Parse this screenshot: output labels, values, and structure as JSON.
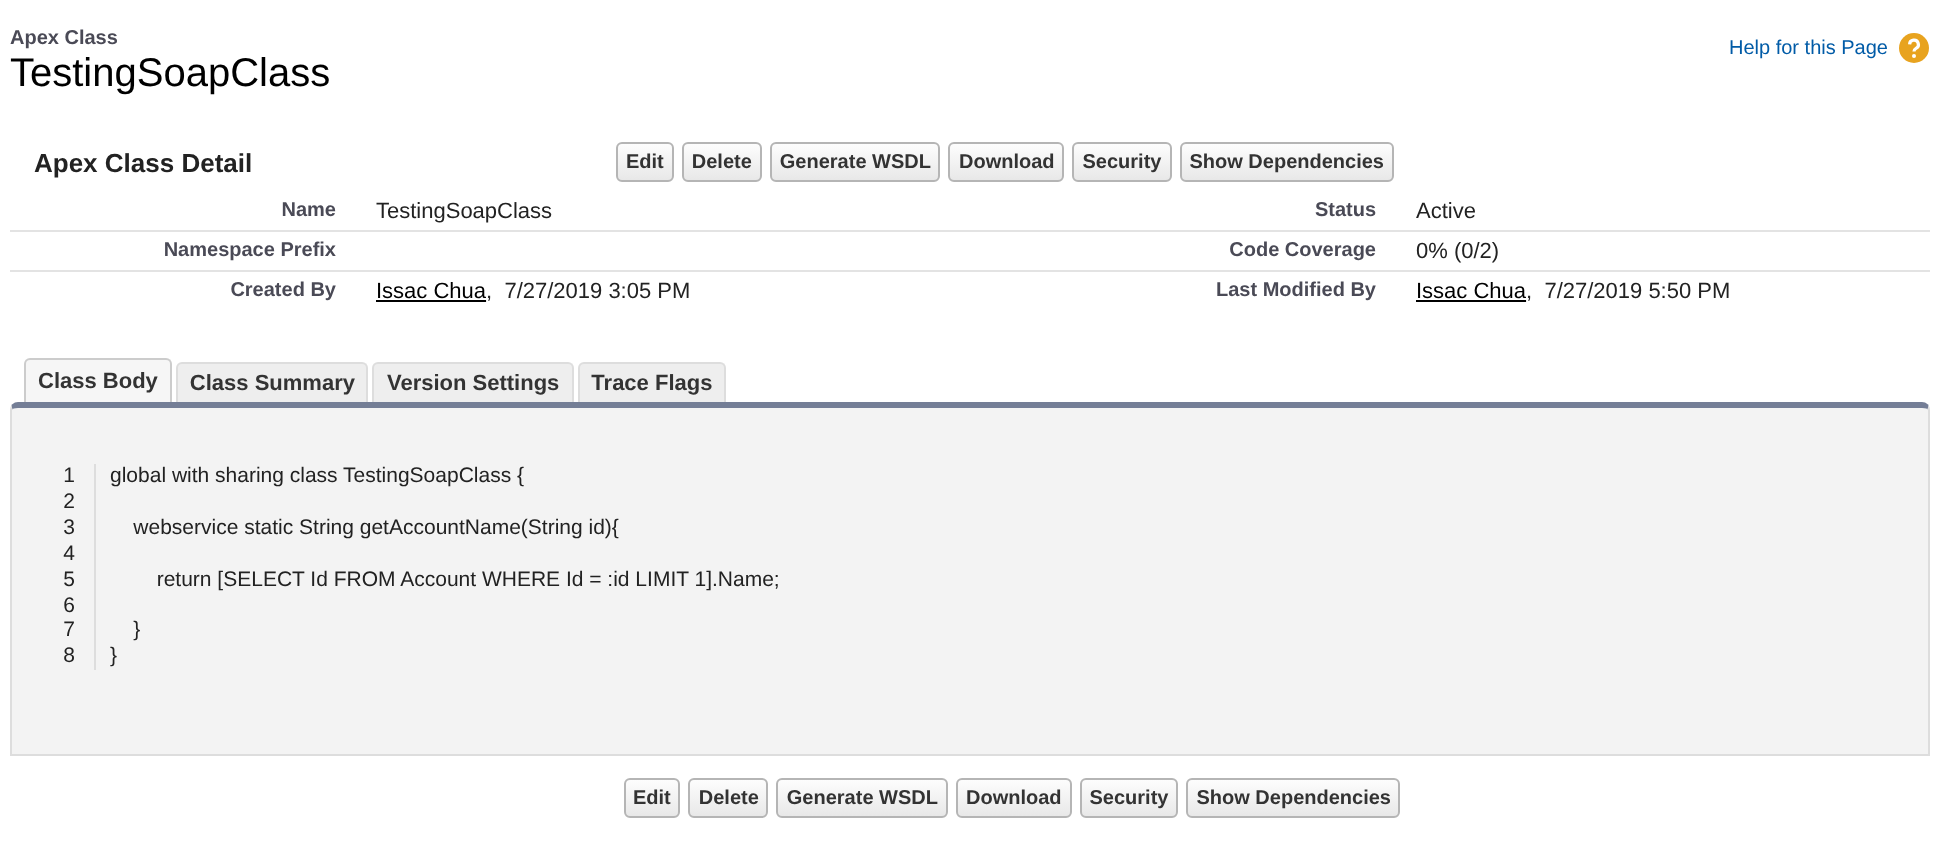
{
  "header": {
    "type_label": "Apex Class",
    "title": "TestingSoapClass",
    "help_link": "Help for this Page"
  },
  "detail": {
    "title": "Apex Class Detail",
    "buttons": [
      "Edit",
      "Delete",
      "Generate WSDL",
      "Download",
      "Security",
      "Show Dependencies"
    ],
    "fields": [
      {
        "label": "Name",
        "value": "TestingSoapClass"
      },
      {
        "label": "Status",
        "value": "Active"
      },
      {
        "label": "Namespace Prefix"
      },
      {
        "label": "Code Coverage",
        "value": "0% (0/2)"
      },
      {
        "label": "Created By",
        "link": "Issac Chua",
        "value": ",  7/27/2019 3:05 PM"
      },
      {
        "label": "Last Modified By",
        "link": "Issac Chua",
        "value": ",  7/27/2019 5:50 PM"
      }
    ]
  },
  "tabs": [
    {
      "label": "Class Body",
      "selected": true
    },
    {
      "label": "Class Summary",
      "selected": false
    },
    {
      "label": "Version Settings",
      "selected": false
    },
    {
      "label": "Trace Flags",
      "selected": false
    }
  ],
  "code": [
    {
      "number": "1",
      "text": "global with sharing class TestingSoapClass {"
    },
    {
      "number": "2"
    },
    {
      "number": "3",
      "text": "    webservice static String getAccountName(String id){"
    },
    {
      "number": "4"
    },
    {
      "number": "5",
      "text": "        return [SELECT Id FROM Account WHERE Id = :id LIMIT 1].Name;"
    },
    {
      "number": "6"
    },
    {
      "number": "7",
      "text": "    }"
    },
    {
      "number": "8",
      "text": "}"
    }
  ],
  "bottom_buttons": [
    "Edit",
    "Delete",
    "Generate WSDL",
    "Download",
    "Security",
    "Show Dependencies"
  ]
}
